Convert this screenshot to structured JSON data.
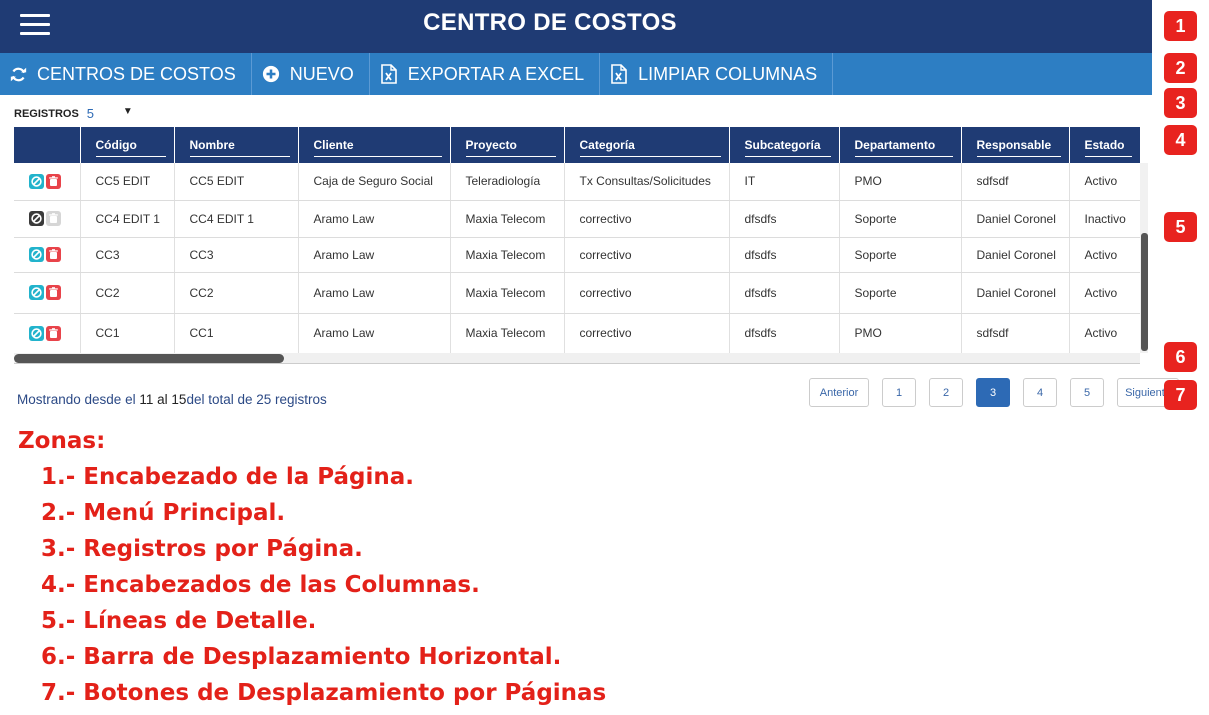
{
  "header": {
    "title": "CENTRO DE COSTOS",
    "menu_icon": "hamburger-icon"
  },
  "menu": [
    {
      "label": "CENTROS DE COSTOS",
      "icon": "refresh-icon"
    },
    {
      "label": "NUEVO",
      "icon": "plus-circle-icon"
    },
    {
      "label": "EXPORTAR A EXCEL",
      "icon": "excel-file-icon"
    },
    {
      "label": "LIMPIAR COLUMNAS",
      "icon": "excel-file-icon"
    }
  ],
  "records": {
    "label": "REGISTROS",
    "value": "5"
  },
  "table": {
    "columns": [
      "",
      "Código",
      "Nombre",
      "Cliente",
      "Proyecto",
      "Categoría",
      "Subcategoría",
      "Departamento",
      "Responsable",
      "Estado"
    ],
    "rows": [
      {
        "state": "enabled",
        "codigo": "CC5 EDIT",
        "nombre": "CC5 EDIT",
        "cliente": "Caja de Seguro Social",
        "proyecto": "Teleradiología",
        "categoria": "Tx Consultas/Solicitudes",
        "subcategoria": "IT",
        "departamento": "PMO",
        "responsable": "sdfsdf",
        "estado": "Activo"
      },
      {
        "state": "disabled",
        "codigo": "CC4 EDIT 1",
        "nombre": "CC4 EDIT 1",
        "cliente": "Aramo Law",
        "proyecto": "Maxia Telecom",
        "categoria": "correctivo",
        "subcategoria": "dfsdfs",
        "departamento": "Soporte",
        "responsable": "Daniel Coronel",
        "estado": "Inactivo"
      },
      {
        "state": "enabled",
        "codigo": "CC3",
        "nombre": "CC3",
        "cliente": "Aramo Law",
        "proyecto": "Maxia Telecom",
        "categoria": "correctivo",
        "subcategoria": "dfsdfs",
        "departamento": "Soporte",
        "responsable": "Daniel Coronel",
        "estado": "Activo"
      },
      {
        "state": "enabled",
        "codigo": "CC2",
        "nombre": "CC2",
        "cliente": "Aramo Law",
        "proyecto": "Maxia Telecom",
        "categoria": "correctivo",
        "subcategoria": "dfsdfs",
        "departamento": "Soporte",
        "responsable": "Daniel Coronel",
        "estado": "Activo"
      },
      {
        "state": "enabled",
        "codigo": "CC1",
        "nombre": "CC1",
        "cliente": "Aramo Law",
        "proyecto": "Maxia Telecom",
        "categoria": "correctivo",
        "subcategoria": "dfsdfs",
        "departamento": "PMO",
        "responsable": "sdfsdf",
        "estado": "Activo"
      }
    ]
  },
  "footer": {
    "showing_prefix": "Mostrando desde el",
    "from": "11",
    "al": "al",
    "to": "15",
    "suffix": "del total de 25 registros"
  },
  "pagination": {
    "prev": "Anterior",
    "pages": [
      "1",
      "2",
      "3",
      "4",
      "5"
    ],
    "active": "3",
    "next": "Siguiente"
  },
  "badges": [
    "1",
    "2",
    "3",
    "4",
    "5",
    "6",
    "7"
  ],
  "zones": {
    "title": "Zonas:",
    "items": [
      "1.- Encabezado de la Página.",
      "2.- Menú Principal.",
      "3.- Registros por Página.",
      "4.- Encabezados de las Columnas.",
      "5.- Líneas de Detalle.",
      "6.- Barra de Desplazamiento Horizontal.",
      "7.- Botones de Desplazamiento por Páginas"
    ]
  },
  "colors": {
    "header_bg": "#1f3b74",
    "menu_bg": "#2d7ec3",
    "edit_button": "#22b3cc",
    "delete_button": "#e8434a",
    "disabled_edit": "#3a3a3a",
    "disabled_delete": "#d6d6d6",
    "badge": "#e8231f",
    "zones_text": "#e32119"
  }
}
